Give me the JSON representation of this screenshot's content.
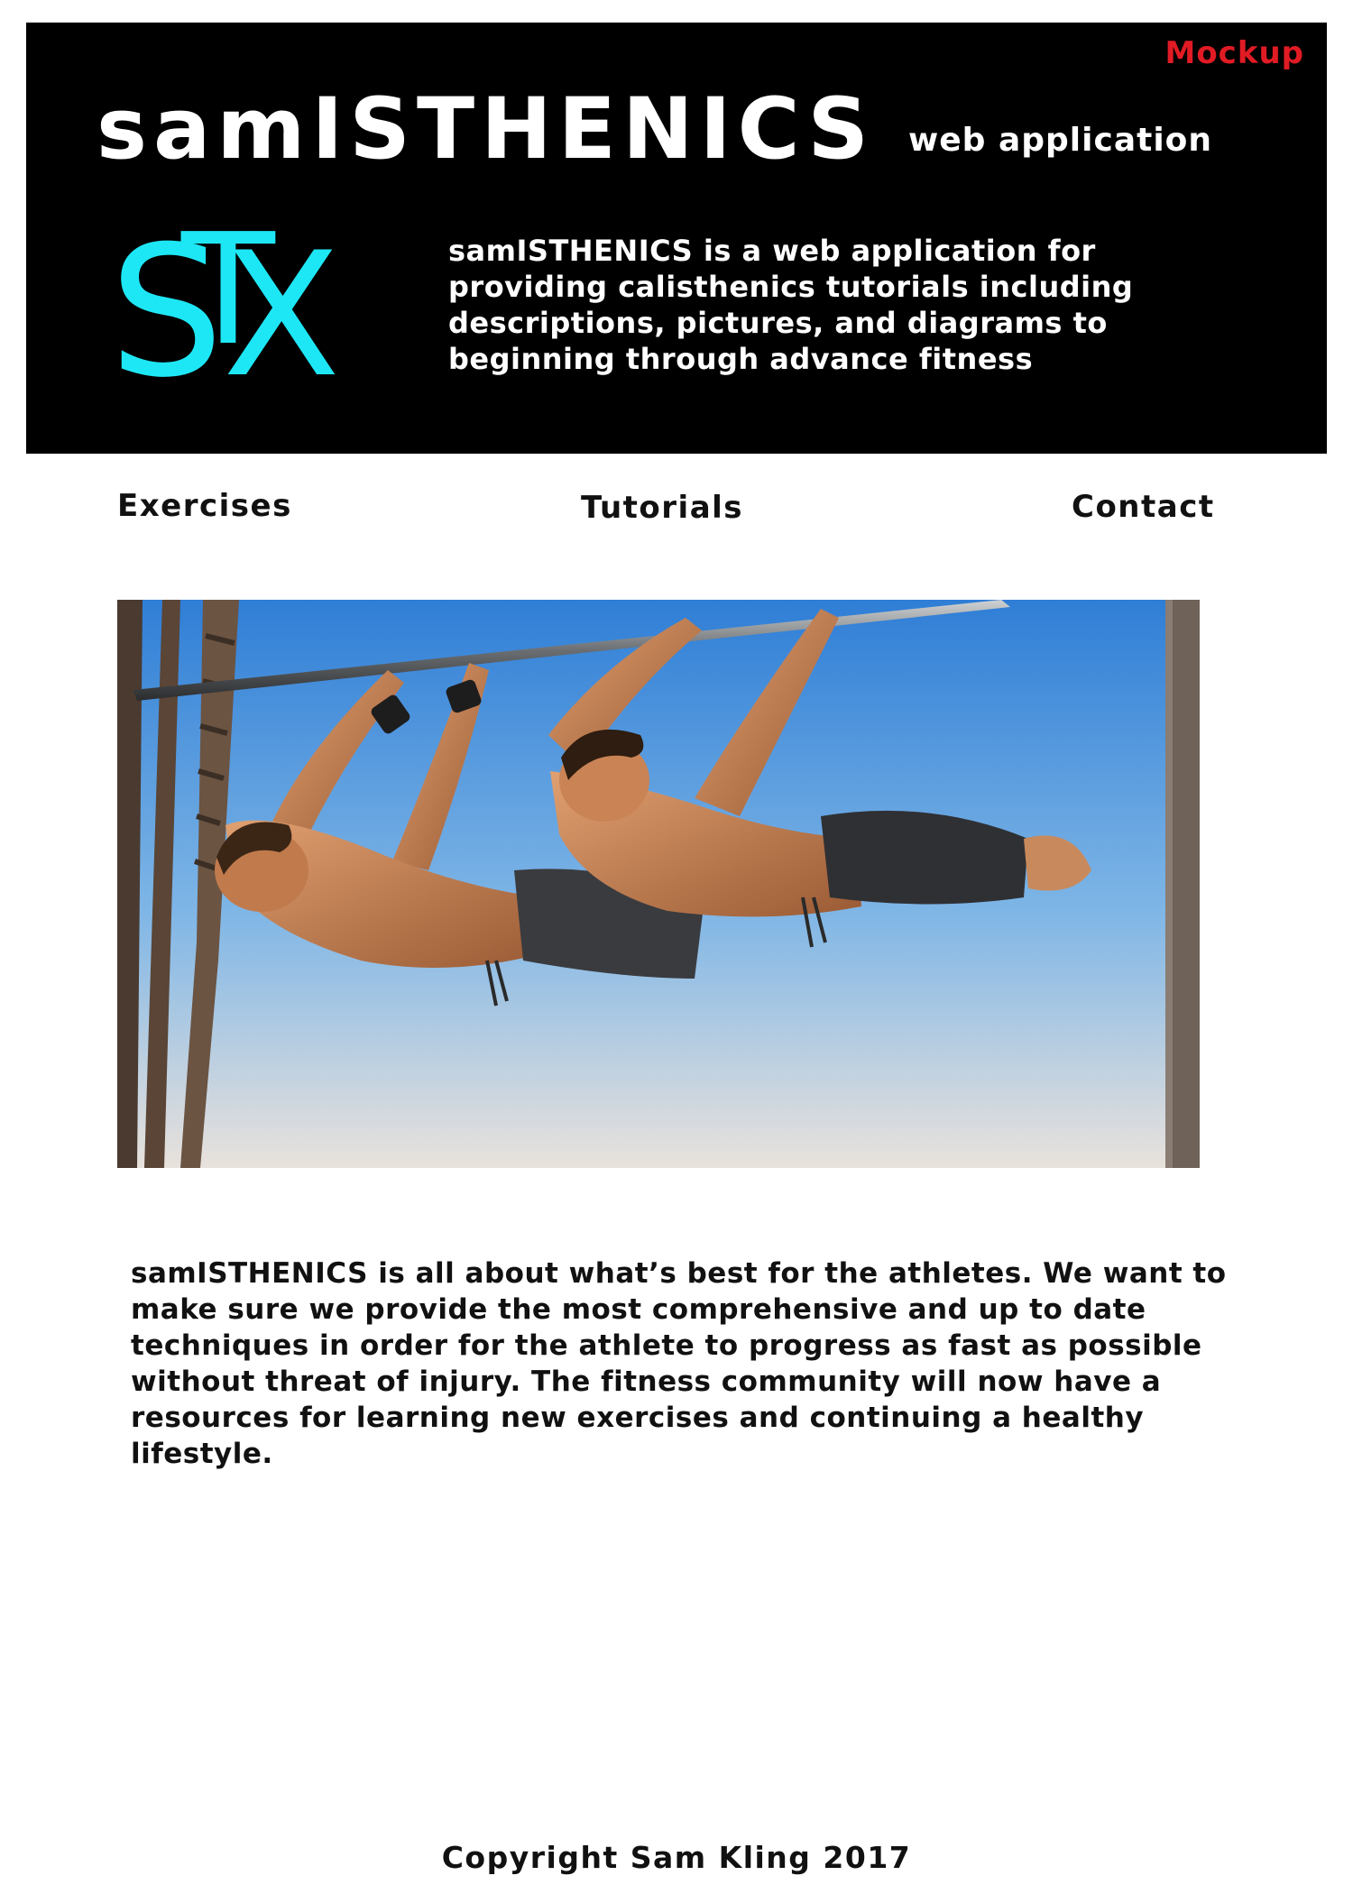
{
  "header": {
    "badge": "Mockup",
    "title": "samISTHENICS",
    "subtitle": "web application",
    "logo_text": "STX",
    "description": "samISTHENICS is a web application for providing calisthenics tutorials including descriptions, pictures, and diagrams to beginning through advance fitness"
  },
  "nav": {
    "exercises": "Exercises",
    "tutorials": "Tutorials",
    "contact": "Contact"
  },
  "hero": {
    "image_subject": "two athletes performing a front lever on a pull-up bar"
  },
  "about": {
    "text": "samISTHENICS is all about what’s best for the athletes. We want to make sure we provide the most comprehensive and up to date techniques in order for the athlete to progress as fast as possible without threat of injury. The fitness community will now have a resources for learning new exercises and continuing a healthy lifestyle."
  },
  "footer": {
    "copyright": "Copyright Sam Kling 2017"
  },
  "colors": {
    "header_bg": "#000000",
    "badge": "#e01b24",
    "logo": "#1ee7f5",
    "text": "#111111"
  }
}
